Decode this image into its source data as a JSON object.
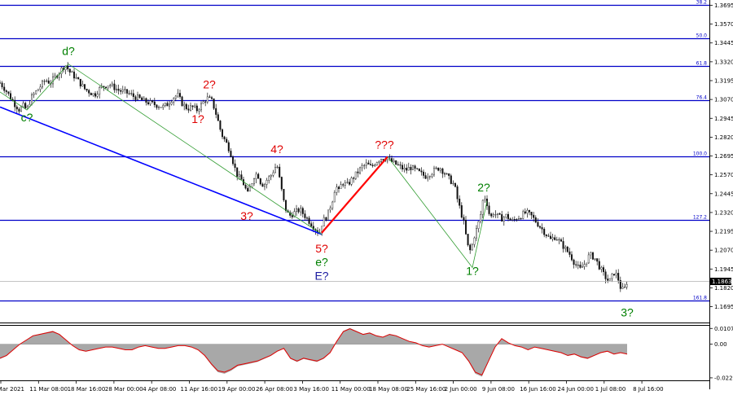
{
  "chart_data": {
    "type": "candlestick",
    "instrument_price": {
      "value": 1.1863,
      "label": "1.1863"
    },
    "price_axis": {
      "ylim": [
        1.159,
        1.373
      ],
      "ticks": [
        "1.3695",
        "1.3570",
        "1.3445",
        "1.3320",
        "1.3195",
        "1.3070",
        "1.2945",
        "1.2820",
        "1.2695",
        "1.2570",
        "1.2445",
        "1.2320",
        "1.2195",
        "1.2070",
        "1.1945",
        "1.1820",
        "1.1695",
        "1.1570"
      ]
    },
    "time_axis": {
      "labels": [
        "1 Mar 2021",
        "11 Mar 08:00",
        "18 Mar 16:00",
        "28 Mar 00:00",
        "4 Apr 08:00",
        "11 Apr 16:00",
        "19 Apr 00:00",
        "26 Apr 08:00",
        "3 May 16:00",
        "11 May 00:00",
        "18 May 08:00",
        "25 May 16:00",
        "2 Jun 00:00",
        "9 Jun 08:00",
        "16 Jun 16:00",
        "24 Jun 00:00",
        "1 Jul 08:00",
        "8 Jul 16:00"
      ]
    },
    "fib_levels": [
      {
        "label": "38.2",
        "price": 1.3695
      },
      {
        "label": "50.0",
        "price": 1.3475
      },
      {
        "label": "61.8",
        "price": 1.329
      },
      {
        "label": "76.4",
        "price": 1.3065
      },
      {
        "label": "100.0",
        "price": 1.2695
      },
      {
        "label": "127.2",
        "price": 1.227
      },
      {
        "label": "161.8",
        "price": 1.1735
      }
    ],
    "price_path": [
      [
        0,
        1.318
      ],
      [
        6,
        1.314
      ],
      [
        12,
        1.309
      ],
      [
        18,
        1.304
      ],
      [
        24,
        1.3
      ],
      [
        28,
        1.303
      ],
      [
        33,
        1.3
      ],
      [
        38,
        1.308
      ],
      [
        44,
        1.312
      ],
      [
        50,
        1.316
      ],
      [
        56,
        1.32
      ],
      [
        62,
        1.318
      ],
      [
        68,
        1.322
      ],
      [
        74,
        1.326
      ],
      [
        80,
        1.33
      ],
      [
        86,
        1.325
      ],
      [
        92,
        1.322
      ],
      [
        98,
        1.318
      ],
      [
        104,
        1.314
      ],
      [
        110,
        1.312
      ],
      [
        116,
        1.31
      ],
      [
        122,
        1.314
      ],
      [
        128,
        1.316
      ],
      [
        134,
        1.317
      ],
      [
        140,
        1.315
      ],
      [
        146,
        1.313
      ],
      [
        152,
        1.312
      ],
      [
        158,
        1.311
      ],
      [
        164,
        1.309
      ],
      [
        170,
        1.308
      ],
      [
        176,
        1.306
      ],
      [
        182,
        1.305
      ],
      [
        188,
        1.304
      ],
      [
        194,
        1.303
      ],
      [
        200,
        1.302
      ],
      [
        206,
        1.304
      ],
      [
        212,
        1.308
      ],
      [
        218,
        1.31
      ],
      [
        224,
        1.304
      ],
      [
        230,
        1.301
      ],
      [
        236,
        1.302
      ],
      [
        242,
        1.3
      ],
      [
        248,
        1.304
      ],
      [
        254,
        1.308
      ],
      [
        260,
        1.306
      ],
      [
        264,
        1.3
      ],
      [
        268,
        1.292
      ],
      [
        272,
        1.284
      ],
      [
        276,
        1.28
      ],
      [
        280,
        1.276
      ],
      [
        284,
        1.27
      ],
      [
        288,
        1.262
      ],
      [
        292,
        1.256
      ],
      [
        296,
        1.254
      ],
      [
        300,
        1.25
      ],
      [
        304,
        1.244
      ],
      [
        308,
        1.25
      ],
      [
        312,
        1.256
      ],
      [
        316,
        1.258
      ],
      [
        320,
        1.252
      ],
      [
        324,
        1.25
      ],
      [
        328,
        1.254
      ],
      [
        332,
        1.256
      ],
      [
        336,
        1.26
      ],
      [
        340,
        1.264
      ],
      [
        344,
        1.252
      ],
      [
        348,
        1.24
      ],
      [
        352,
        1.232
      ],
      [
        356,
        1.23
      ],
      [
        362,
        1.232
      ],
      [
        368,
        1.234
      ],
      [
        374,
        1.23
      ],
      [
        380,
        1.226
      ],
      [
        386,
        1.222
      ],
      [
        392,
        1.218
      ],
      [
        396,
        1.226
      ],
      [
        402,
        1.23
      ],
      [
        408,
        1.24
      ],
      [
        412,
        1.25
      ],
      [
        416,
        1.246
      ],
      [
        420,
        1.252
      ],
      [
        426,
        1.25
      ],
      [
        432,
        1.254
      ],
      [
        438,
        1.258
      ],
      [
        444,
        1.262
      ],
      [
        450,
        1.264
      ],
      [
        456,
        1.262
      ],
      [
        462,
        1.266
      ],
      [
        468,
        1.268
      ],
      [
        474,
        1.268
      ],
      [
        480,
        1.266
      ],
      [
        486,
        1.264
      ],
      [
        492,
        1.262
      ],
      [
        498,
        1.26
      ],
      [
        504,
        1.262
      ],
      [
        510,
        1.26
      ],
      [
        516,
        1.258
      ],
      [
        522,
        1.256
      ],
      [
        528,
        1.258
      ],
      [
        534,
        1.26
      ],
      [
        540,
        1.262
      ],
      [
        546,
        1.258
      ],
      [
        552,
        1.254
      ],
      [
        558,
        1.25
      ],
      [
        562,
        1.24
      ],
      [
        566,
        1.232
      ],
      [
        570,
        1.224
      ],
      [
        574,
        1.21
      ],
      [
        578,
        1.206
      ],
      [
        582,
        1.216
      ],
      [
        586,
        1.222
      ],
      [
        590,
        1.23
      ],
      [
        594,
        1.244
      ],
      [
        598,
        1.238
      ],
      [
        602,
        1.228
      ],
      [
        606,
        1.232
      ],
      [
        610,
        1.23
      ],
      [
        616,
        1.228
      ],
      [
        622,
        1.23
      ],
      [
        628,
        1.226
      ],
      [
        634,
        1.228
      ],
      [
        640,
        1.23
      ],
      [
        646,
        1.232
      ],
      [
        652,
        1.23
      ],
      [
        658,
        1.226
      ],
      [
        664,
        1.222
      ],
      [
        670,
        1.218
      ],
      [
        676,
        1.214
      ],
      [
        682,
        1.216
      ],
      [
        688,
        1.212
      ],
      [
        694,
        1.208
      ],
      [
        700,
        1.204
      ],
      [
        706,
        1.198
      ],
      [
        712,
        1.194
      ],
      [
        718,
        1.198
      ],
      [
        724,
        1.204
      ],
      [
        730,
        1.202
      ],
      [
        736,
        1.196
      ],
      [
        742,
        1.19
      ],
      [
        748,
        1.186
      ],
      [
        754,
        1.192
      ],
      [
        758,
        1.19
      ],
      [
        762,
        1.182
      ],
      [
        766,
        1.18
      ],
      [
        770,
        1.1863
      ]
    ],
    "wave_labels": [
      {
        "text": "d?",
        "time_index": 84,
        "price": 1.3365,
        "color": "#008000"
      },
      {
        "text": "c?",
        "time_index": 33,
        "price": 1.2925,
        "color": "#008000"
      },
      {
        "text": "2?",
        "time_index": 257,
        "price": 1.3145,
        "color": "#e00000"
      },
      {
        "text": "1?",
        "time_index": 243,
        "price": 1.2915,
        "color": "#e00000"
      },
      {
        "text": "4?",
        "time_index": 340,
        "price": 1.2715,
        "color": "#e00000"
      },
      {
        "text": "3?",
        "time_index": 303,
        "price": 1.227,
        "color": "#e00000"
      },
      {
        "text": "???",
        "time_index": 472,
        "price": 1.2745,
        "color": "#e00000"
      },
      {
        "text": "5?",
        "time_index": 395,
        "price": 1.2055,
        "color": "#e00000"
      },
      {
        "text": "e?",
        "time_index": 395,
        "price": 1.1965,
        "color": "#008000"
      },
      {
        "text": "E?",
        "time_index": 395,
        "price": 1.1875,
        "color": "#1a1aa0"
      },
      {
        "text": "2?",
        "time_index": 594,
        "price": 1.246,
        "color": "#008000"
      },
      {
        "text": "1?",
        "time_index": 580,
        "price": 1.1905,
        "color": "#008000"
      },
      {
        "text": "3?",
        "time_index": 770,
        "price": 1.163,
        "color": "#008000"
      }
    ],
    "trend_lines": [
      {
        "color": "#0000ff",
        "width": 1.6,
        "points": [
          [
            0,
            1.302
          ],
          [
            395,
            1.2175
          ]
        ]
      },
      {
        "color": "#ff0000",
        "width": 2.2,
        "points": [
          [
            395,
            1.2185
          ],
          [
            476,
            1.269
          ]
        ]
      },
      {
        "color": "#2e9b2e",
        "width": 0.8,
        "points": [
          [
            0,
            1.312
          ],
          [
            33,
            1.3
          ],
          [
            84,
            1.3305
          ],
          [
            395,
            1.2175
          ]
        ]
      },
      {
        "color": "#2e9b2e",
        "width": 0.8,
        "points": [
          [
            476,
            1.269
          ],
          [
            580,
            1.1955
          ],
          [
            598,
            1.2395
          ]
        ]
      }
    ],
    "oscillator": {
      "ticks": [
        "0.0107",
        "0.00",
        "-0.0228"
      ],
      "ylim": [
        -0.0245,
        0.0125
      ],
      "values": [
        -0.01,
        -0.008,
        -0.004,
        0.0,
        0.003,
        0.006,
        0.007,
        0.008,
        0.009,
        0.007,
        0.003,
        -0.001,
        -0.004,
        -0.005,
        -0.004,
        -0.003,
        -0.002,
        -0.002,
        -0.003,
        -0.004,
        -0.004,
        -0.002,
        -0.001,
        -0.002,
        -0.003,
        -0.003,
        -0.002,
        -0.001,
        -0.001,
        -0.002,
        -0.004,
        -0.008,
        -0.014,
        -0.019,
        -0.02,
        -0.018,
        -0.015,
        -0.014,
        -0.013,
        -0.012,
        -0.01,
        -0.008,
        -0.005,
        -0.003,
        -0.01,
        -0.012,
        -0.01,
        -0.011,
        -0.012,
        -0.01,
        -0.006,
        0.002,
        0.009,
        0.011,
        0.009,
        0.007,
        0.008,
        0.006,
        0.005,
        0.007,
        0.006,
        0.004,
        0.002,
        0.001,
        -0.001,
        -0.002,
        -0.001,
        0.0,
        -0.002,
        -0.004,
        -0.006,
        -0.012,
        -0.02,
        -0.022,
        -0.012,
        -0.002,
        0.004,
        0.001,
        -0.001,
        -0.002,
        -0.004,
        -0.002,
        -0.003,
        -0.004,
        -0.005,
        -0.006,
        -0.008,
        -0.007,
        -0.009,
        -0.01,
        -0.008,
        -0.006,
        -0.005,
        -0.007,
        -0.006,
        -0.007
      ]
    }
  }
}
